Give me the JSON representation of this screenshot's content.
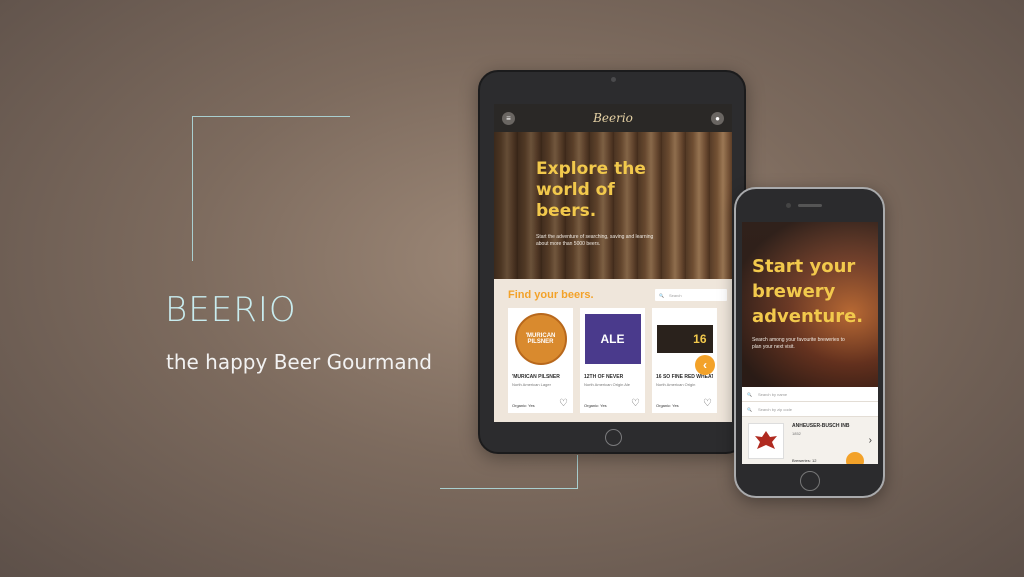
{
  "brand": {
    "title": "BEERIO",
    "tagline": "the happy Beer Gourmand"
  },
  "tablet": {
    "logo": "Beerio",
    "menu_icon": "menu-icon",
    "user_icon": "user-icon",
    "hero": {
      "title": "Explore the world of beers.",
      "text": "Start the adventure of searching, saving and learning about more than 5000 beers."
    },
    "find_title": "Find your beers.",
    "search_placeholder": "Search",
    "cards": [
      {
        "name": "'MURICAN PILSNER",
        "style": "North American Lager",
        "organic": "Organic: Yes",
        "label_text": "'MURICAN PILSNER",
        "label_color": "#d98a2e"
      },
      {
        "name": "12TH OF NEVER",
        "style": "North American Origin Ale",
        "organic": "Organic: Yes",
        "label_text": "ALE",
        "label_color": "#4a3a8c"
      },
      {
        "name": "16 SO FINE RED WHEAT",
        "style": "North American Origin",
        "organic": "Organic: Yes",
        "label_text": "16",
        "label_color": "#2a221c"
      }
    ],
    "fab_symbol": "‹"
  },
  "phone": {
    "hero": {
      "title": "Start your brewery adventure.",
      "text": "Search among your favourite breweries to plan your next visit."
    },
    "search_name_placeholder": "Search by name",
    "search_zip_placeholder": "Search by zip code",
    "brewery": {
      "name": "ANHEUSER-BUSCH INB",
      "year": "1852",
      "count": "Breweries: 12"
    }
  },
  "colors": {
    "accent": "#f3a229",
    "hero_yellow": "#f2c94c",
    "line": "#a9cfd0"
  }
}
